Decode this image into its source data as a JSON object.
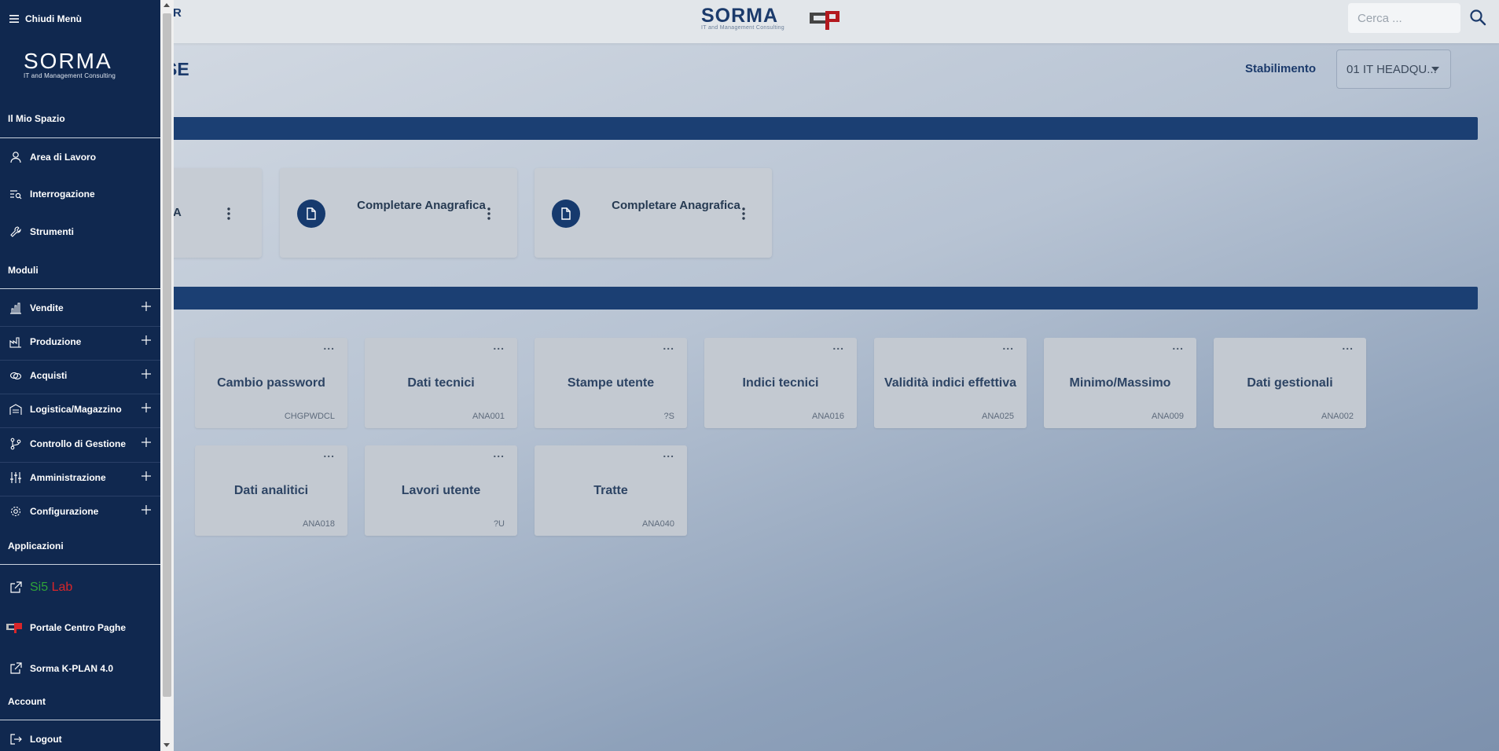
{
  "topbar": {
    "title_fragment": "R",
    "brand_word": "SORMA",
    "brand_tag": "IT and Management Consulting",
    "search_placeholder": "Cerca ..."
  },
  "page": {
    "title_fragment": "SE",
    "stabilimento_label": "Stabilimento",
    "stabilimento_value": "01 IT HEADQU..."
  },
  "quick_cards": [
    {
      "label": "A"
    },
    {
      "label": "Completare Anagrafica"
    },
    {
      "label": "Completare Anagrafica"
    }
  ],
  "tiles": [
    {
      "label": "Cambio password",
      "code": "CHGPWDCL"
    },
    {
      "label": "Dati tecnici",
      "code": "ANA001"
    },
    {
      "label": "Stampe utente",
      "code": "?S"
    },
    {
      "label": "Indici tecnici",
      "code": "ANA016"
    },
    {
      "label": "Validità indici effettiva",
      "code": "ANA025"
    },
    {
      "label": "Minimo/Massimo",
      "code": "ANA009"
    },
    {
      "label": "Dati gestionali",
      "code": "ANA002"
    },
    {
      "label": "Dati analitici",
      "code": "ANA018"
    },
    {
      "label": "Lavori utente",
      "code": "?U"
    },
    {
      "label": "Tratte",
      "code": "ANA040"
    }
  ],
  "tile_dots": "...",
  "sidebar": {
    "close_label": "Chiudi Menù",
    "logo_word": "SORMA",
    "logo_tag": "IT and Management Consulting",
    "section_mio_spazio": "Il Mio Spazio",
    "area_lavoro": "Area di Lavoro",
    "interrogazione": "Interrogazione",
    "strumenti": "Strumenti",
    "section_moduli": "Moduli",
    "vendite": "Vendite",
    "produzione": "Produzione",
    "acquisti": "Acquisti",
    "logistica": "Logistica/Magazzino",
    "controllo": "Controllo di Gestione",
    "amministrazione": "Amministrazione",
    "configurazione": "Configurazione",
    "section_applicazioni": "Applicazioni",
    "sislab_a": "Si5",
    "sislab_b": "Lab",
    "portale": "Portale Centro Paghe",
    "kplan": "Sorma K-PLAN 4.0",
    "section_account": "Account",
    "logout": "Logout"
  },
  "colors": {
    "navy": "#10284f",
    "band": "#1b3f73",
    "sislab_green": "#2fa33a",
    "sislab_red": "#d9262a",
    "cp_red": "#b3191f"
  }
}
